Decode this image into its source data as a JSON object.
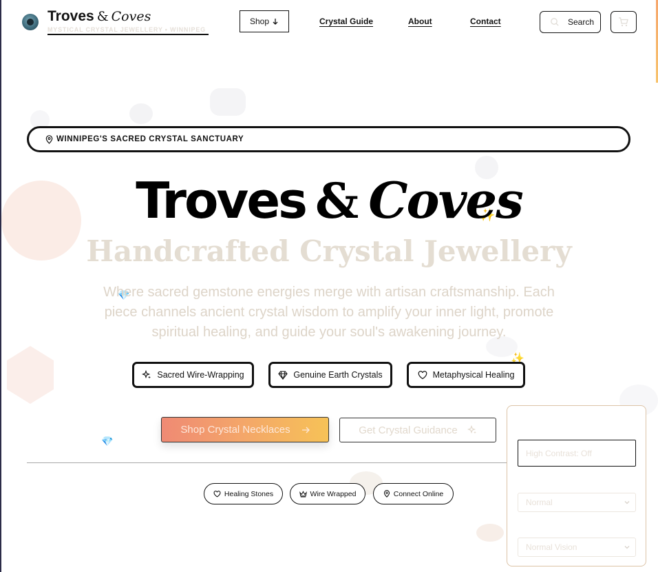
{
  "header": {
    "brand_main": "Troves",
    "brand_amp": "&",
    "brand_script": "Coves",
    "tagline": "MYSTICAL CRYSTAL JEWELLERY • WINNIPEG",
    "shop_label": "Shop",
    "nav": [
      {
        "label": "Crystal Guide"
      },
      {
        "label": "About"
      },
      {
        "label": "Contact"
      }
    ],
    "search_label": "Search"
  },
  "hero": {
    "location": "WINNIPEG'S SACRED CRYSTAL SANCTUARY",
    "title_main": "Troves",
    "title_amp": "&",
    "title_script": "Coves",
    "subtitle": "Handcrafted Crystal Jewellery",
    "description": "Where sacred gemstone energies merge with artisan craftsmanship. Each piece channels ancient crystal wisdom to amplify your inner light, promote spiritual healing, and guide your soul's awakening journey.",
    "features": [
      {
        "label": "Sacred Wire-Wrapping",
        "icon": "sparkles-icon"
      },
      {
        "label": "Genuine Earth Crystals",
        "icon": "diamond-icon"
      },
      {
        "label": "Metaphysical Healing",
        "icon": "heart-icon"
      }
    ],
    "cta_primary": "Shop Crystal Necklaces",
    "cta_secondary": "Get Crystal Guidance",
    "tags": [
      {
        "label": "Healing Stones",
        "icon": "heart-icon"
      },
      {
        "label": "Wire Wrapped",
        "icon": "crown-icon"
      },
      {
        "label": "Connect Online",
        "icon": "map-pin-icon"
      }
    ]
  },
  "accessibility": {
    "contrast_label": "High Contrast: Off",
    "text_size_value": "Normal",
    "vision_value": "Normal Vision"
  },
  "colors": {
    "accent_start": "#ef8a74",
    "accent_end": "#f6c257",
    "faded_text": "#ddd4c8"
  }
}
